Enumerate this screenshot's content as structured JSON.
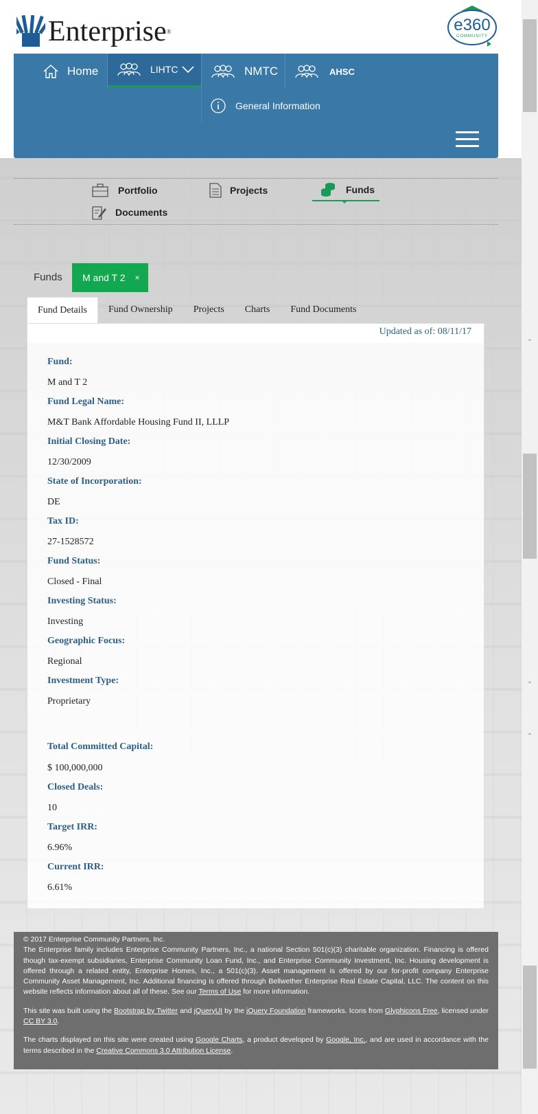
{
  "brand": {
    "name": "Enterprise",
    "registered": "®",
    "badge_main": "e360",
    "badge_sub": "COMMUNITY"
  },
  "main_nav": {
    "items": [
      {
        "label": "Home",
        "icon": "home-icon"
      },
      {
        "label": "LIHTC",
        "icon": "people-icon"
      },
      {
        "label": "NMTC",
        "icon": "people-icon"
      },
      {
        "label": "AHSC",
        "icon": "people-icon"
      }
    ],
    "sub_item": {
      "label": "General Information",
      "icon": "info-icon"
    },
    "menu_icon": "hamburger-icon",
    "colors": {
      "bar": "#3a78a8",
      "active_underline": "#1a9a5a"
    }
  },
  "sub_nav": {
    "items": [
      {
        "label": "Portfolio",
        "icon": "briefcase-icon"
      },
      {
        "label": "Projects",
        "icon": "document-icon"
      },
      {
        "label": "Funds",
        "icon": "coins-icon"
      },
      {
        "label": "Documents",
        "icon": "edit-document-icon"
      }
    ],
    "active": "Funds"
  },
  "breadcrumb": {
    "root": "Funds",
    "chip_label": "M and T 2",
    "chip_close": "×",
    "chip_color": "#12a84f"
  },
  "tabs": [
    "Fund Details",
    "Fund Ownership",
    "Projects",
    "Charts",
    "Fund Documents"
  ],
  "active_tab": "Fund Details",
  "updated_as_of": "Updated as of: 08/11/17",
  "fund_details": [
    {
      "label": "Fund:",
      "value": "M and T 2"
    },
    {
      "label": "Fund Legal Name:",
      "value": "M&T Bank Affordable Housing Fund II, LLLP"
    },
    {
      "label": "Initial Closing Date:",
      "value": "12/30/2009"
    },
    {
      "label": "State of Incorporation:",
      "value": "DE"
    },
    {
      "label": "Tax ID:",
      "value": "27-1528572"
    },
    {
      "label": "Fund Status:",
      "value": "Closed - Final"
    },
    {
      "label": "Investing Status:",
      "value": "Investing"
    },
    {
      "label": "Geographic Focus:",
      "value": "Regional"
    },
    {
      "label": "Investment Type:",
      "value": "Proprietary"
    }
  ],
  "fund_financials": [
    {
      "label": "Total Committed Capital:",
      "value": "$ 100,000,000"
    },
    {
      "label": "Closed Deals:",
      "value": "10"
    },
    {
      "label": "Target IRR:",
      "value": "6.96%"
    },
    {
      "label": "Current IRR:",
      "value": "6.61%"
    }
  ],
  "footer": {
    "copyright": "© 2017 Enterprise Community Partners, Inc.",
    "para1_text": "The Enterprise family includes Enterprise Community Partners, Inc., a national Section 501(c)(3) charitable organization. Financing is offered though tax-exempt subsidiaries, Enterprise Community Loan Fund, Inc., and Enterprise Community Investment, Inc. Housing development is offered through a related entity, Enterprise Homes, Inc., a 501(c)(3). Asset management is offered by our for-profit company Enterprise Community Asset Management, Inc. Additional financing is offered through Bellwether Enterprise Real Estate Capital, LLC. The content on this website reflects information about all of these. See our",
    "terms_link": "Terms of Use",
    "para1_tail": "for more information.",
    "para2_a": "This site was built using the",
    "bootstrap_link": "Bootstrap by Twitter",
    "para2_b": "and",
    "jqueryui_link": "jQueryUI",
    "para2_c": "by the",
    "jquery_foundation_link": "jQuery Foundation",
    "para2_d": "frameworks. Icons from",
    "glyphicons_link": "Glyphicons Free",
    "para2_e": ", licensed under",
    "ccby_link": "CC BY 3.0",
    "para2_f": ".",
    "para3_a": "The charts displayed on this site were created using",
    "google_charts_link": "Google Charts",
    "para3_b": ", a product developed by",
    "google_link": "Google, Inc.",
    "para3_c": ", and are used in accordance with the terms described in the",
    "cc_attr_link": "Creative Commons 3.0 Attribution License",
    "para3_d": "."
  }
}
